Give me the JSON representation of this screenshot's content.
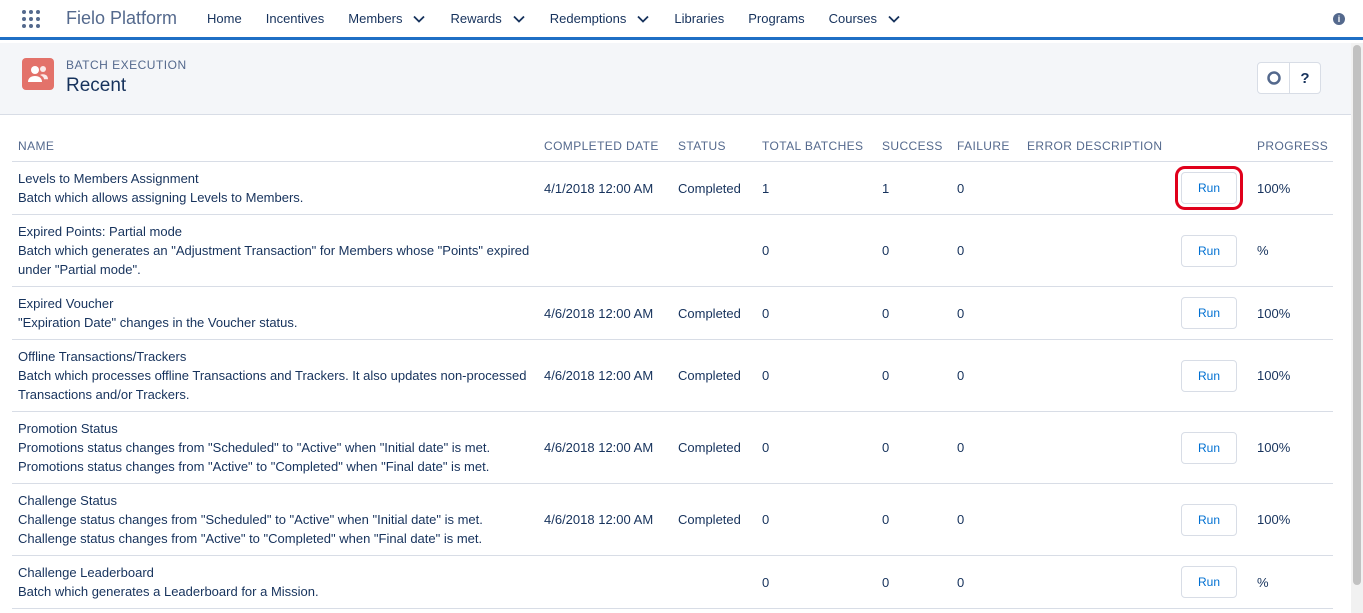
{
  "app": {
    "name": "Fielo Platform"
  },
  "nav": {
    "items": [
      {
        "label": "Home",
        "dropdown": false
      },
      {
        "label": "Incentives",
        "dropdown": false
      },
      {
        "label": "Members",
        "dropdown": true
      },
      {
        "label": "Rewards",
        "dropdown": true
      },
      {
        "label": "Redemptions",
        "dropdown": true
      },
      {
        "label": "Libraries",
        "dropdown": false
      },
      {
        "label": "Programs",
        "dropdown": false
      },
      {
        "label": "Courses",
        "dropdown": true
      }
    ]
  },
  "header": {
    "eyebrow": "BATCH EXECUTION",
    "title": "Recent",
    "help_label": "?"
  },
  "table": {
    "columns": [
      "NAME",
      "COMPLETED DATE",
      "STATUS",
      "TOTAL BATCHES",
      "SUCCESS",
      "FAILURE",
      "ERROR DESCRIPTION",
      "",
      "PROGRESS"
    ],
    "run_label": "Run",
    "rows": [
      {
        "title": "Levels to Members Assignment",
        "desc": "Batch which allows assigning Levels to Members.",
        "date": "4/1/2018 12:00 AM",
        "status": "Completed",
        "total": "1",
        "success": "1",
        "failure": "0",
        "error": "",
        "progress": "100%",
        "highlight": true
      },
      {
        "title": "Expired Points: Partial mode",
        "desc": "Batch which generates an \"Adjustment Transaction\" for Members whose \"Points\" expired under \"Partial mode\".",
        "date": "",
        "status": "",
        "total": "0",
        "success": "0",
        "failure": "0",
        "error": "",
        "progress": "%",
        "highlight": false
      },
      {
        "title": "Expired Voucher",
        "desc": "\"Expiration Date\" changes in the Voucher status.",
        "date": "4/6/2018 12:00 AM",
        "status": "Completed",
        "total": "0",
        "success": "0",
        "failure": "0",
        "error": "",
        "progress": "100%",
        "highlight": false
      },
      {
        "title": "Offline Transactions/Trackers",
        "desc": "Batch which processes offline Transactions and Trackers. It also updates non-processed Transactions and/or Trackers.",
        "date": "4/6/2018 12:00 AM",
        "status": "Completed",
        "total": "0",
        "success": "0",
        "failure": "0",
        "error": "",
        "progress": "100%",
        "highlight": false
      },
      {
        "title": "Promotion Status",
        "desc": "Promotions status changes from \"Scheduled\" to \"Active\" when \"Initial date\" is met. Promotions status changes from \"Active\" to \"Completed\" when \"Final date\" is met.",
        "date": "4/6/2018 12:00 AM",
        "status": "Completed",
        "total": "0",
        "success": "0",
        "failure": "0",
        "error": "",
        "progress": "100%",
        "highlight": false
      },
      {
        "title": "Challenge Status",
        "desc": "Challenge status changes from \"Scheduled\" to \"Active\" when \"Initial date\" is met. Challenge status changes from \"Active\" to \"Completed\" when \"Final date\" is met.",
        "date": "4/6/2018 12:00 AM",
        "status": "Completed",
        "total": "0",
        "success": "0",
        "failure": "0",
        "error": "",
        "progress": "100%",
        "highlight": false
      },
      {
        "title": "Challenge Leaderboard",
        "desc": "Batch which generates a Leaderboard for a Mission.",
        "date": "",
        "status": "",
        "total": "0",
        "success": "0",
        "failure": "0",
        "error": "",
        "progress": "%",
        "highlight": false
      }
    ]
  },
  "colors": {
    "accent": "#1f6fc5",
    "link": "#0070d2",
    "highlight": "#e0001b",
    "header_icon": "#e3726a"
  }
}
